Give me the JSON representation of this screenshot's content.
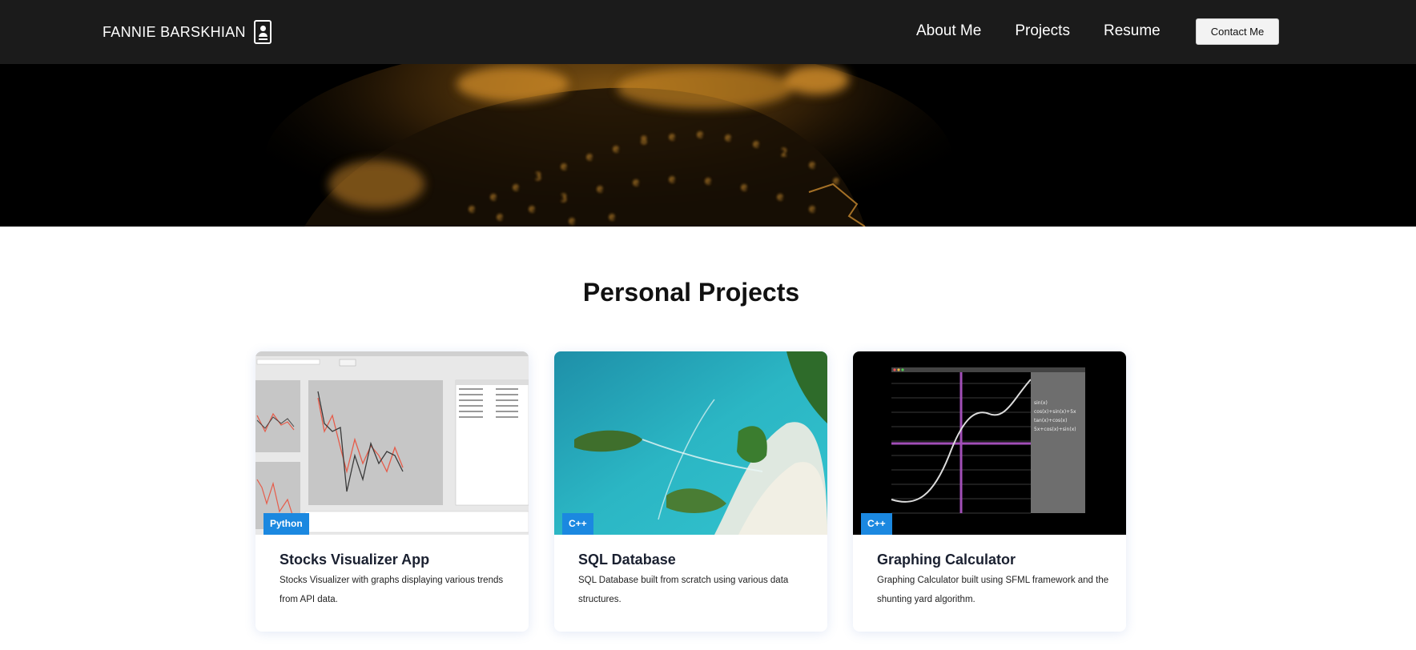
{
  "nav": {
    "brand": "FANNIE BARSKHIAN",
    "brand_icon": "contact-card-icon",
    "links": [
      "About Me",
      "Projects",
      "Resume"
    ],
    "contact_label": "Contact Me"
  },
  "section": {
    "title": "Personal Projects"
  },
  "projects": [
    {
      "title": "Stocks Visualizer App",
      "description": "Stocks Visualizer with graphs displaying various trends from API data.",
      "tag": "Python"
    },
    {
      "title": "SQL Database",
      "description": "SQL Database built from scratch using various data structures.",
      "tag": "C++"
    },
    {
      "title": "Graphing Calculator",
      "description": "Graphing Calculator built using SFML framework and the shunting yard algorithm.",
      "tag": "C++"
    }
  ],
  "calculator_preview": {
    "equations": [
      "sin(x)",
      "cos(x)+sin(x)+5x",
      "tan(x)+cos(x)",
      "5x+cos(x)+sin(x)"
    ]
  },
  "colors": {
    "nav_bg": "#1b1b1b",
    "badge_bg": "#1b88e0",
    "hero_accent": "#d9922a"
  }
}
